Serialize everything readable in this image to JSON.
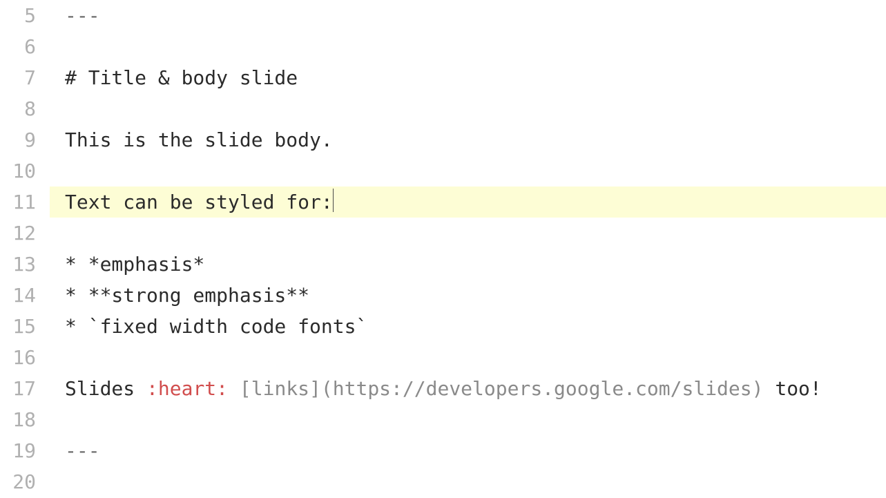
{
  "editor": {
    "start_line_number": 5,
    "active_line_number": 11,
    "lines": [
      {
        "n": 5,
        "segments": [
          {
            "cls": "delim",
            "text": "---"
          }
        ]
      },
      {
        "n": 6,
        "segments": []
      },
      {
        "n": 7,
        "segments": [
          {
            "cls": "",
            "text": "# Title & body slide"
          }
        ]
      },
      {
        "n": 8,
        "segments": []
      },
      {
        "n": 9,
        "segments": [
          {
            "cls": "",
            "text": "This is the slide body."
          }
        ]
      },
      {
        "n": 10,
        "segments": []
      },
      {
        "n": 11,
        "segments": [
          {
            "cls": "",
            "text": "Text can be styled for:"
          }
        ],
        "cursor_after": true,
        "current": true
      },
      {
        "n": 12,
        "segments": []
      },
      {
        "n": 13,
        "segments": [
          {
            "cls": "",
            "text": "* *emphasis*"
          }
        ]
      },
      {
        "n": 14,
        "segments": [
          {
            "cls": "",
            "text": "* **strong emphasis**"
          }
        ]
      },
      {
        "n": 15,
        "segments": [
          {
            "cls": "",
            "text": "* `fixed width code fonts`"
          }
        ]
      },
      {
        "n": 16,
        "segments": []
      },
      {
        "n": 17,
        "segments": [
          {
            "cls": "",
            "text": "Slides "
          },
          {
            "cls": "emoji",
            "text": ":heart:"
          },
          {
            "cls": "",
            "text": " "
          },
          {
            "cls": "link",
            "text": "[links](https://developers.google.com/slides)"
          },
          {
            "cls": "",
            "text": " too!"
          }
        ]
      },
      {
        "n": 18,
        "segments": []
      },
      {
        "n": 19,
        "segments": [
          {
            "cls": "delim",
            "text": "---"
          }
        ]
      },
      {
        "n": 20,
        "segments": []
      }
    ]
  }
}
